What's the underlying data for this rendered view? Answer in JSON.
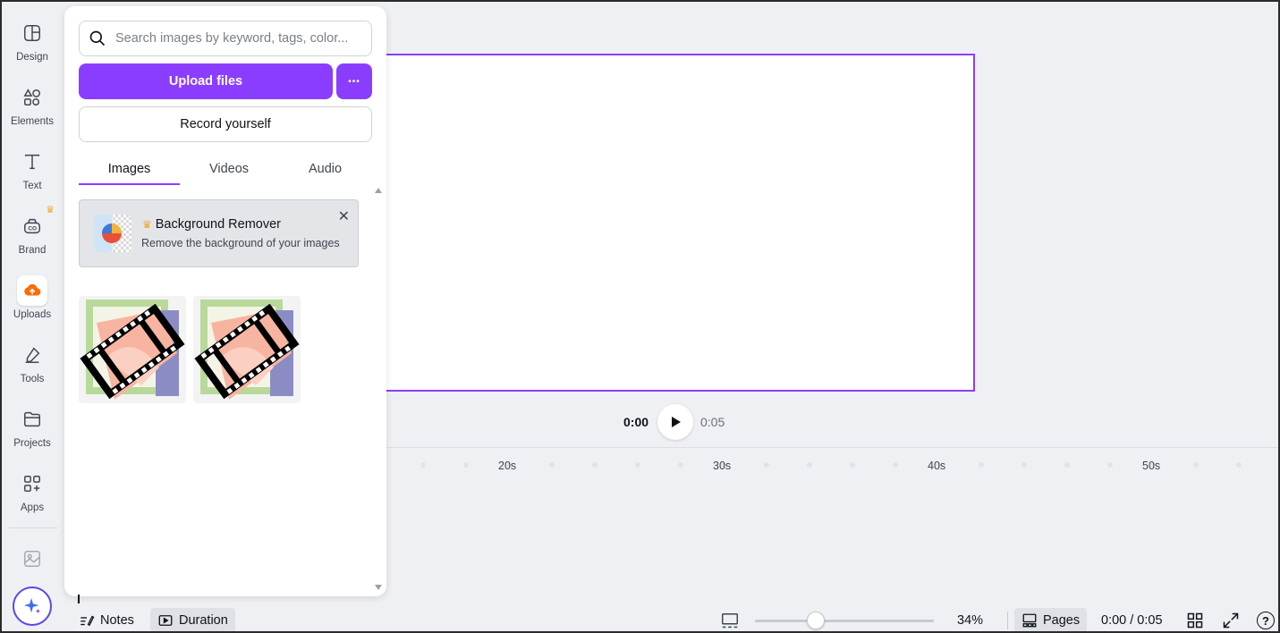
{
  "rail": {
    "items": [
      {
        "label": "Design",
        "icon": "design-icon"
      },
      {
        "label": "Elements",
        "icon": "elements-icon"
      },
      {
        "label": "Text",
        "icon": "text-icon"
      },
      {
        "label": "Brand",
        "icon": "brand-icon"
      },
      {
        "label": "Uploads",
        "icon": "uploads-icon"
      },
      {
        "label": "Tools",
        "icon": "tools-icon"
      },
      {
        "label": "Projects",
        "icon": "projects-icon"
      },
      {
        "label": "Apps",
        "icon": "apps-icon"
      }
    ],
    "active": "Uploads"
  },
  "panel": {
    "search_placeholder": "Search images by keyword, tags, color...",
    "upload_label": "Upload files",
    "more_label": "•••",
    "record_label": "Record yourself",
    "tabs": [
      "Images",
      "Videos",
      "Audio"
    ],
    "active_tab": "Images",
    "promo": {
      "title": "Background Remover",
      "crown": "♛",
      "description": "Remove the background of your images",
      "close": "✕"
    },
    "thumbnails": [
      {
        "icon": "video-clip-icon"
      },
      {
        "icon": "video-clip-icon"
      }
    ]
  },
  "player": {
    "current": "0:00",
    "total": "0:05"
  },
  "timeline": {
    "ticks": [
      "20s",
      "30s",
      "40s",
      "50s"
    ]
  },
  "bottom": {
    "notes": "Notes",
    "duration": "Duration",
    "zoom": "34%",
    "zoom_value": 0.34,
    "pages": "Pages",
    "time": "0:00 / 0:05",
    "help": "?"
  },
  "colors": {
    "accent": "#8b3dff",
    "background": "#eff0f4"
  }
}
